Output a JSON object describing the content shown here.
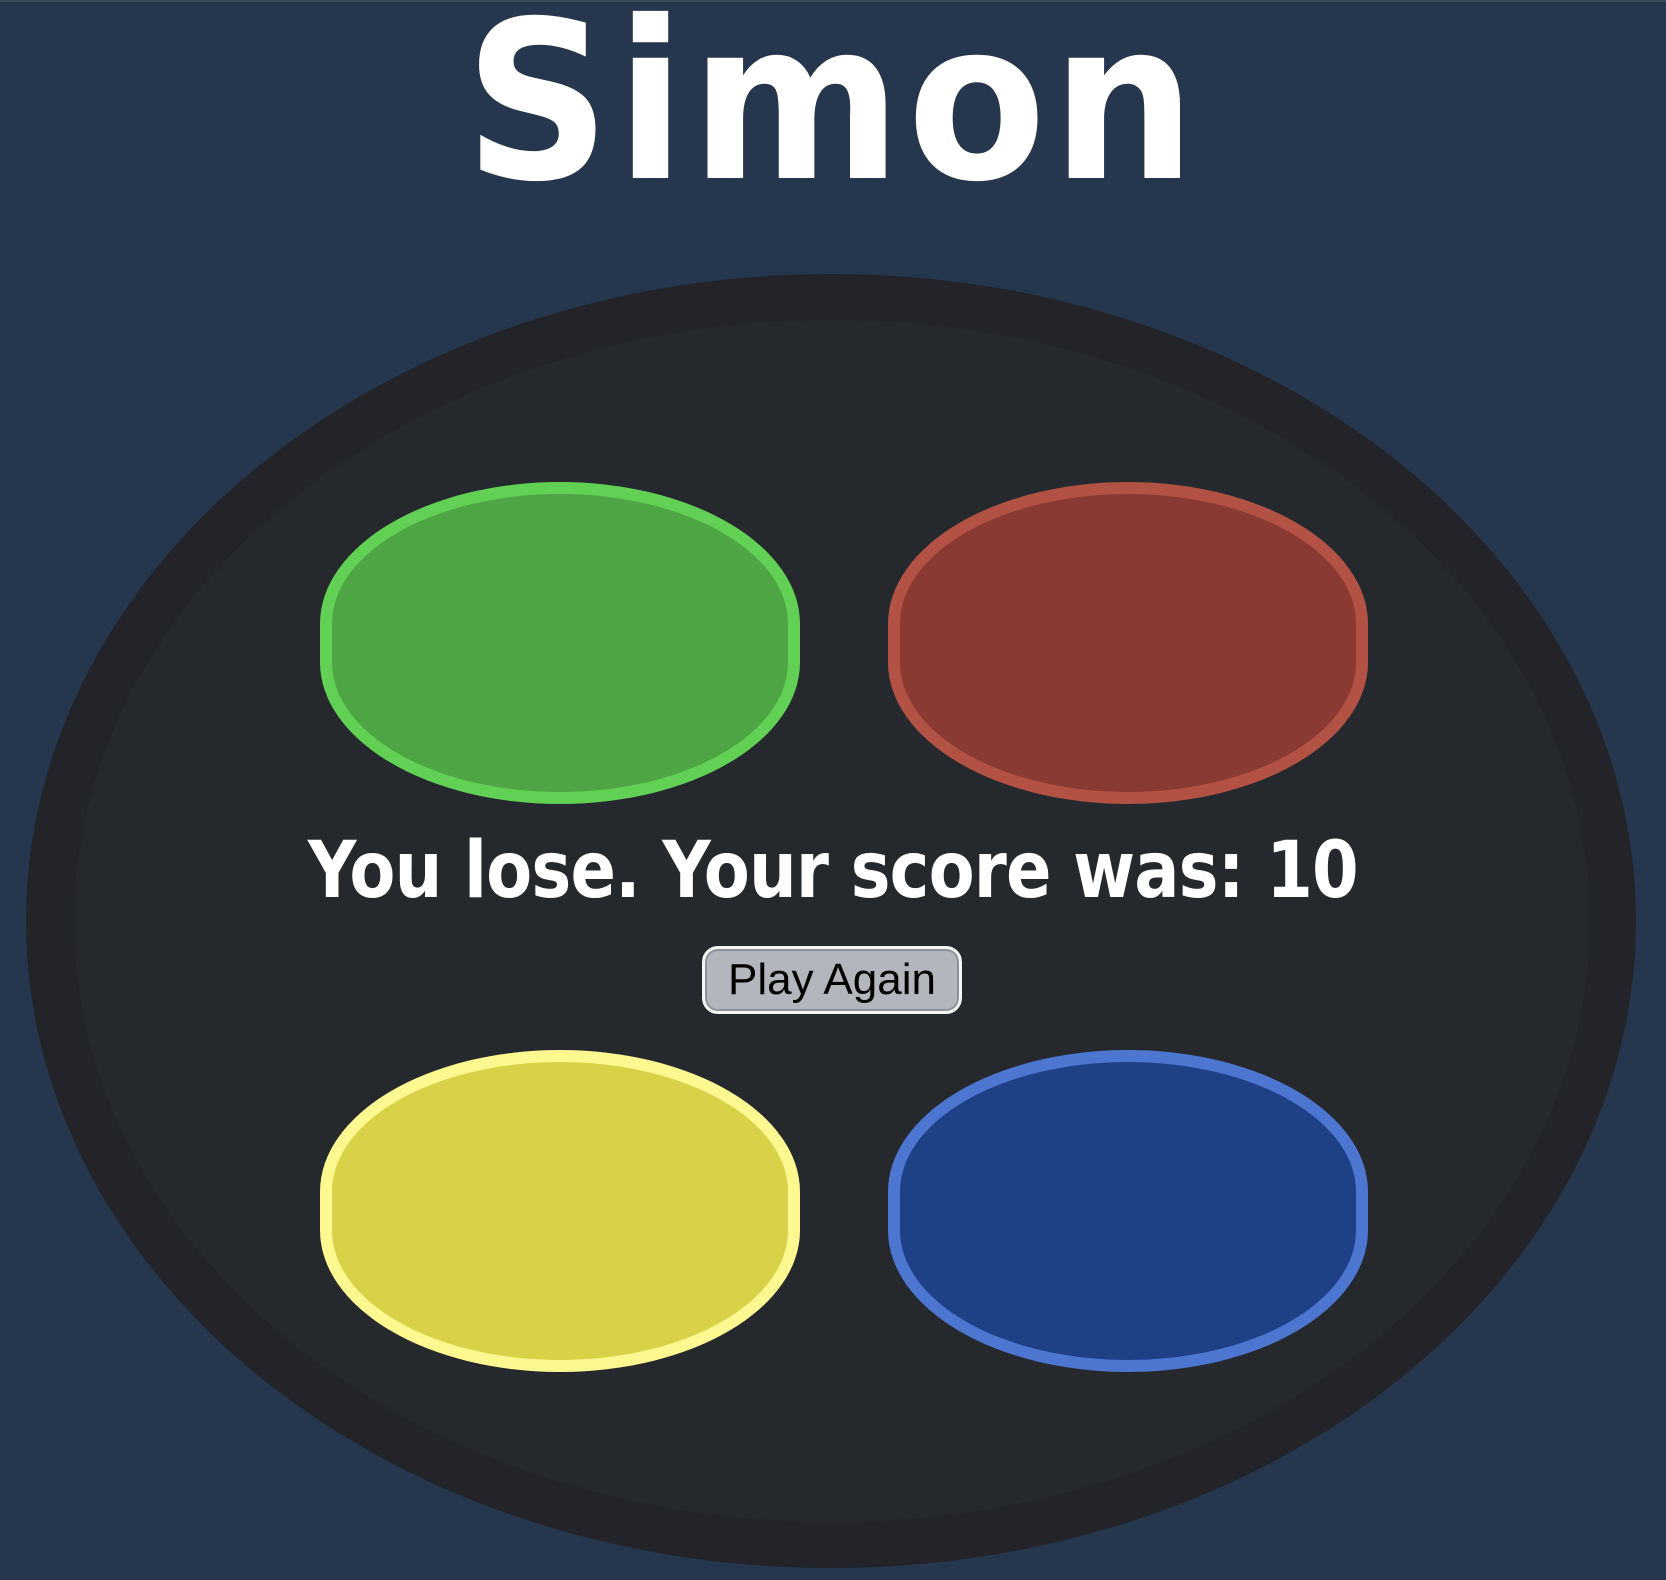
{
  "title": "Simon",
  "status_message": "You lose. Your score was: 10",
  "play_again_label": "Play Again",
  "pads": [
    {
      "name": "green",
      "fill": "#4ea544",
      "border": "#62d055"
    },
    {
      "name": "red",
      "fill": "#8b3a31",
      "border": "#b25244"
    },
    {
      "name": "yellow",
      "fill": "#d7d247",
      "border": "#fdf890"
    },
    {
      "name": "blue",
      "fill": "#1e4087",
      "border": "#4d76d1"
    }
  ],
  "colors": {
    "page_background": "#25364d",
    "board_outer": "#222429",
    "board_inner": "#25282d",
    "text": "#ffffff"
  }
}
